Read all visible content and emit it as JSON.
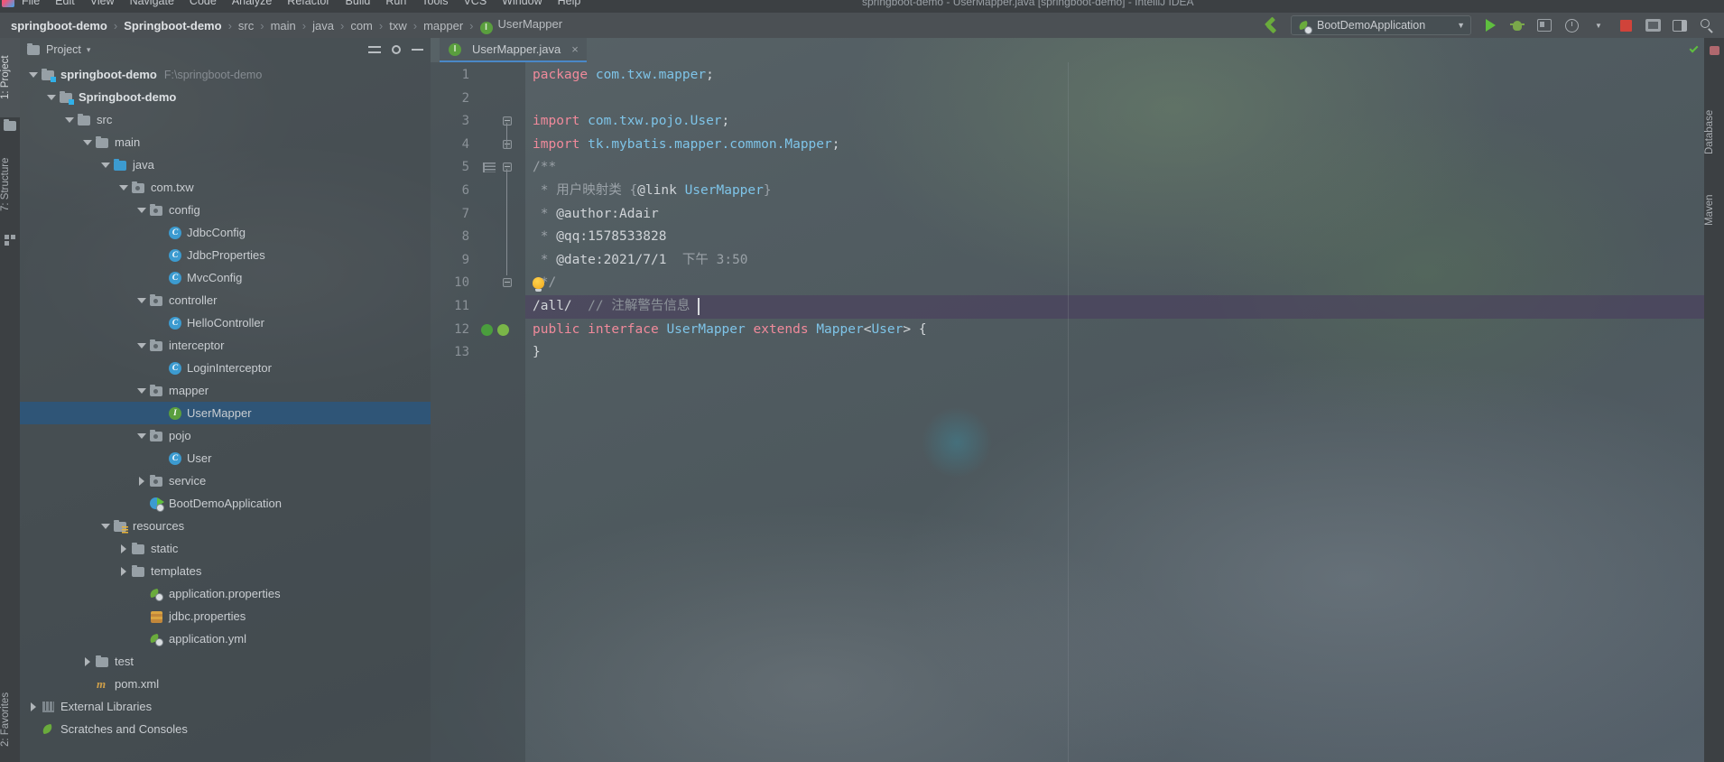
{
  "window": {
    "title": "springboot-demo - UserMapper.java [springboot-demo] - IntelliJ IDEA",
    "menu": [
      "File",
      "Edit",
      "View",
      "Navigate",
      "Code",
      "Analyze",
      "Refactor",
      "Build",
      "Run",
      "Tools",
      "VCS",
      "Window",
      "Help"
    ]
  },
  "breadcrumb": {
    "items": [
      "springboot-demo",
      "Springboot-demo",
      "src",
      "main",
      "java",
      "com",
      "txw",
      "mapper"
    ],
    "leaf": "UserMapper",
    "leaf_badge": "I",
    "separator": "›"
  },
  "toolbar": {
    "build_icon": "hammer-icon",
    "run_config": "BootDemoApplication",
    "run_config_caret": "▼",
    "buttons": [
      "run-button",
      "debug-button",
      "run-coverage-button",
      "profiler-button",
      "stop-button",
      "git-update-button",
      "layout-button",
      "search-everywhere-button"
    ]
  },
  "left_strip": {
    "items": [
      "1: Project",
      "7: Structure"
    ],
    "bottom": "2: Favorites"
  },
  "right_strip": {
    "items": [
      "Database",
      "Maven"
    ]
  },
  "project_panel": {
    "title": "Project",
    "title_caret": "▾",
    "actions": [
      "collapse-all-icon",
      "settings-icon",
      "hide-icon"
    ],
    "tree": [
      {
        "label": "springboot-demo",
        "path": "F:\\springboot-demo",
        "depth": 0,
        "arrow": "down",
        "icon": "module-folder",
        "bold": true
      },
      {
        "label": "Springboot-demo",
        "path": "",
        "depth": 1,
        "arrow": "down",
        "icon": "module-folder",
        "bold": true
      },
      {
        "label": "src",
        "path": "",
        "depth": 2,
        "arrow": "down",
        "icon": "folder",
        "bold": false
      },
      {
        "label": "main",
        "path": "",
        "depth": 3,
        "arrow": "down",
        "icon": "folder",
        "bold": false
      },
      {
        "label": "java",
        "path": "",
        "depth": 4,
        "arrow": "down",
        "icon": "source-folder",
        "bold": false
      },
      {
        "label": "com.txw",
        "path": "",
        "depth": 5,
        "arrow": "down",
        "icon": "package",
        "bold": false
      },
      {
        "label": "config",
        "path": "",
        "depth": 6,
        "arrow": "down",
        "icon": "package",
        "bold": false
      },
      {
        "label": "JdbcConfig",
        "path": "",
        "depth": 7,
        "arrow": "none",
        "icon": "class",
        "bold": false
      },
      {
        "label": "JdbcProperties",
        "path": "",
        "depth": 7,
        "arrow": "none",
        "icon": "class",
        "bold": false
      },
      {
        "label": "MvcConfig",
        "path": "",
        "depth": 7,
        "arrow": "none",
        "icon": "class",
        "bold": false
      },
      {
        "label": "controller",
        "path": "",
        "depth": 6,
        "arrow": "down",
        "icon": "package",
        "bold": false
      },
      {
        "label": "HelloController",
        "path": "",
        "depth": 7,
        "arrow": "none",
        "icon": "class",
        "bold": false
      },
      {
        "label": "interceptor",
        "path": "",
        "depth": 6,
        "arrow": "down",
        "icon": "package",
        "bold": false
      },
      {
        "label": "LoginInterceptor",
        "path": "",
        "depth": 7,
        "arrow": "none",
        "icon": "class",
        "bold": false
      },
      {
        "label": "mapper",
        "path": "",
        "depth": 6,
        "arrow": "down",
        "icon": "package",
        "bold": false
      },
      {
        "label": "UserMapper",
        "path": "",
        "depth": 7,
        "arrow": "none",
        "icon": "interface",
        "bold": false,
        "selected": true
      },
      {
        "label": "pojo",
        "path": "",
        "depth": 6,
        "arrow": "down",
        "icon": "package",
        "bold": false
      },
      {
        "label": "User",
        "path": "",
        "depth": 7,
        "arrow": "none",
        "icon": "class",
        "bold": false
      },
      {
        "label": "service",
        "path": "",
        "depth": 6,
        "arrow": "right",
        "icon": "package",
        "bold": false
      },
      {
        "label": "BootDemoApplication",
        "path": "",
        "depth": 6,
        "arrow": "none",
        "icon": "spring-class",
        "bold": false
      },
      {
        "label": "resources",
        "path": "",
        "depth": 4,
        "arrow": "down",
        "icon": "resource-folder",
        "bold": false
      },
      {
        "label": "static",
        "path": "",
        "depth": 5,
        "arrow": "right",
        "icon": "folder",
        "bold": false
      },
      {
        "label": "templates",
        "path": "",
        "depth": 5,
        "arrow": "right",
        "icon": "folder",
        "bold": false
      },
      {
        "label": "application.properties",
        "path": "",
        "depth": 6,
        "arrow": "none",
        "icon": "spring-config",
        "bold": false
      },
      {
        "label": "jdbc.properties",
        "path": "",
        "depth": 6,
        "arrow": "none",
        "icon": "properties",
        "bold": false
      },
      {
        "label": "application.yml",
        "path": "",
        "depth": 6,
        "arrow": "none",
        "icon": "spring-config",
        "bold": false
      },
      {
        "label": "test",
        "path": "",
        "depth": 3,
        "arrow": "right",
        "icon": "folder",
        "bold": false
      },
      {
        "label": "pom.xml",
        "path": "",
        "depth": 3,
        "arrow": "none",
        "icon": "maven",
        "bold": false
      },
      {
        "label": "External Libraries",
        "path": "",
        "depth": 0,
        "arrow": "right",
        "icon": "library",
        "bold": false
      },
      {
        "label": "Scratches and Consoles",
        "path": "",
        "depth": 0,
        "arrow": "none",
        "icon": "scratch",
        "bold": false
      }
    ]
  },
  "editor": {
    "tab": {
      "label": "UserMapper.java",
      "badge": "I",
      "close": "×"
    },
    "line_numbers": [
      "1",
      "2",
      "3",
      "4",
      "5",
      "6",
      "7",
      "8",
      "9",
      "10",
      "11",
      "12",
      "13"
    ],
    "caret_line": 11,
    "code": [
      {
        "n": 1,
        "segments": [
          {
            "t": "package",
            "c": "kw"
          },
          {
            "t": " ",
            "c": "plain"
          },
          {
            "t": "com.txw.mapper",
            "c": "id"
          },
          {
            "t": ";",
            "c": "plain"
          }
        ]
      },
      {
        "n": 2,
        "segments": []
      },
      {
        "n": 3,
        "segments": [
          {
            "t": "import",
            "c": "kw"
          },
          {
            "t": " ",
            "c": "plain"
          },
          {
            "t": "com.txw.pojo.User",
            "c": "id"
          },
          {
            "t": ";",
            "c": "plain"
          }
        ]
      },
      {
        "n": 4,
        "segments": [
          {
            "t": "import",
            "c": "kw"
          },
          {
            "t": " ",
            "c": "plain"
          },
          {
            "t": "tk.mybatis.mapper.common.Mapper",
            "c": "id"
          },
          {
            "t": ";",
            "c": "plain"
          }
        ]
      },
      {
        "n": 5,
        "segments": [
          {
            "t": "/**",
            "c": "doc"
          }
        ]
      },
      {
        "n": 6,
        "segments": [
          {
            "t": " * ",
            "c": "doc"
          },
          {
            "t": "用户映射类 ",
            "c": "doc"
          },
          {
            "t": "{",
            "c": "doc"
          },
          {
            "t": "@link",
            "c": "tag"
          },
          {
            "t": " ",
            "c": "doc"
          },
          {
            "t": "UserMapper",
            "c": "lnk"
          },
          {
            "t": "}",
            "c": "doc"
          }
        ]
      },
      {
        "n": 7,
        "segments": [
          {
            "t": " * ",
            "c": "doc"
          },
          {
            "t": "@author:Adair",
            "c": "tag"
          }
        ]
      },
      {
        "n": 8,
        "segments": [
          {
            "t": " * ",
            "c": "doc"
          },
          {
            "t": "@qq:1578533828",
            "c": "tag"
          }
        ]
      },
      {
        "n": 9,
        "segments": [
          {
            "t": " * ",
            "c": "doc"
          },
          {
            "t": "@date:2021/7/1",
            "c": "tag"
          },
          {
            "t": "  下午 3:50",
            "c": "doc"
          }
        ]
      },
      {
        "n": 10,
        "segments": [
          {
            "t": " */",
            "c": "doc"
          }
        ]
      },
      {
        "n": 11,
        "segments": [
          {
            "t": "/all/",
            "c": "pn"
          },
          {
            "t": "  ",
            "c": "plain"
          },
          {
            "t": "// 注解警告信息",
            "c": "cm"
          }
        ]
      },
      {
        "n": 12,
        "segments": [
          {
            "t": "public",
            "c": "kw"
          },
          {
            "t": " ",
            "c": "plain"
          },
          {
            "t": "interface",
            "c": "kw"
          },
          {
            "t": " ",
            "c": "plain"
          },
          {
            "t": "UserMapper",
            "c": "id"
          },
          {
            "t": " ",
            "c": "plain"
          },
          {
            "t": "extends",
            "c": "kw"
          },
          {
            "t": " ",
            "c": "plain"
          },
          {
            "t": "Mapper",
            "c": "id"
          },
          {
            "t": "<",
            "c": "plain"
          },
          {
            "t": "User",
            "c": "id"
          },
          {
            "t": "> {",
            "c": "plain"
          }
        ]
      },
      {
        "n": 13,
        "segments": [
          {
            "t": "}",
            "c": "plain"
          }
        ]
      }
    ],
    "gutter_icons": {
      "bulb_line": 10,
      "interface_markers_line": 12,
      "doc_fold_line": 5
    },
    "inspection_status": "ok-check-icon"
  }
}
